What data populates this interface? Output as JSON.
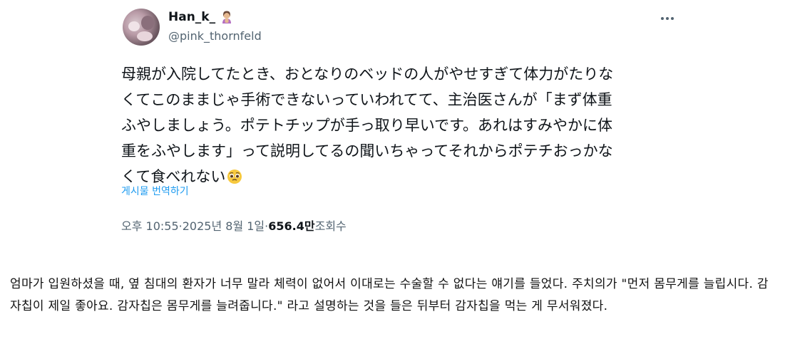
{
  "tweet": {
    "display_name": "Han_k_",
    "handle": "@pink_thornfeld",
    "text": "母親が入院してたとき、おとなりのベッドの人がやせすぎて体力がたりな\nくてこのままじゃ手術できないっていわれてて、主治医さんが「まず体重\nふやしましょう。ポテトチップが手っ取り早いです。あれはすみやかに体\n重をふやします」って説明してるの聞いちゃってそれからポテチおっかな\nくて食べれない",
    "translate_label": "게시물 번역하기",
    "time": "오후 10:55",
    "separator": " · ",
    "date": "2025년 8월 1일",
    "views_count": "656.4만",
    "views_label": " 조회수",
    "icons": {
      "avatar": "avatar-photo",
      "name_emoji": "woman-gesturing-emoji",
      "more": "more-options-icon",
      "text_emoji": "pleading-face-emoji"
    }
  },
  "translation": {
    "text": "엄마가 입원하셨을 때, 옆 침대의 환자가 너무 말라 체력이 없어서 이대로는 수술할 수 없다는 얘기를 들었다. 주치의가 \"먼저 몸무게를 늘립시다. 감자칩이 제일 좋아요. 감자칩은 몸무게를 늘려줍니다.\" 라고 설명하는 것을 들은 뒤부터 감자칩을 먹는 게 무서워졌다."
  },
  "colors": {
    "link": "#1d9bf0",
    "secondary_text": "#536471",
    "primary_text": "#0f1419"
  }
}
